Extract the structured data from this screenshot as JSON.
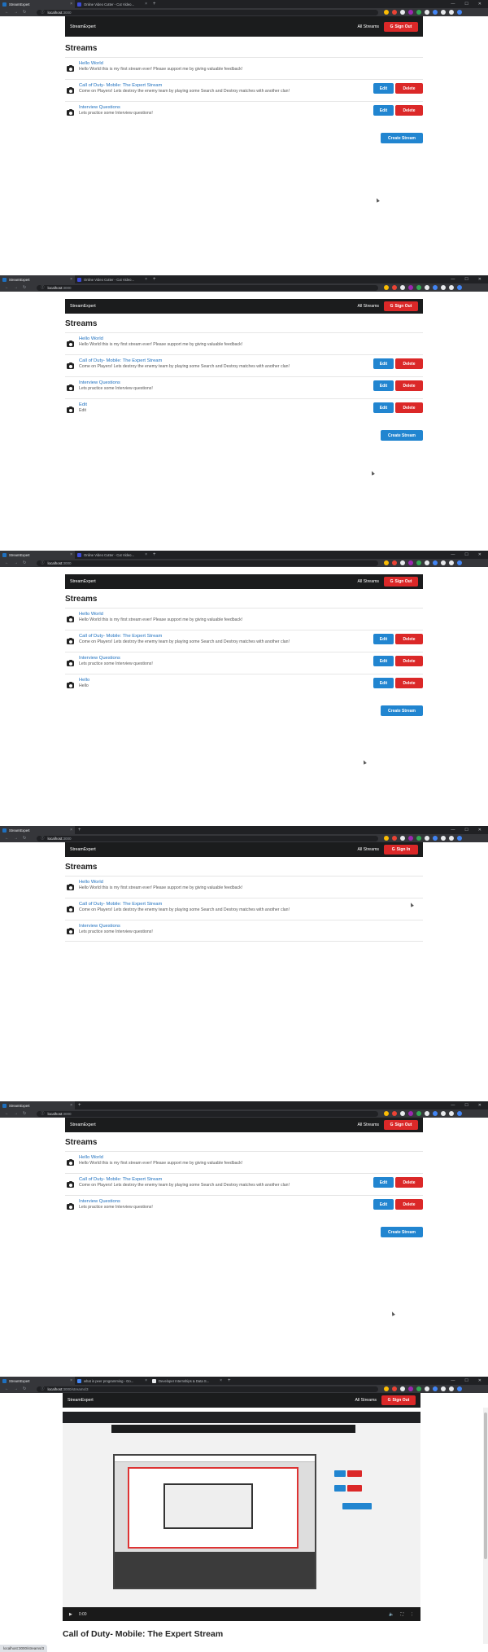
{
  "browser": {
    "tab_main": "StreamExpert",
    "tab_cutter": "Online Video Cutter - Cut Video...",
    "url_host": "localhost",
    "url_port": ":3000",
    "url_path": "/streams/3",
    "tab_search": "what is peer programming - Go...",
    "tab_internships": "Developer Internships & Data S...",
    "status_url": "localhost:3000/streams/3"
  },
  "app": {
    "brand": "StreamExpert",
    "all_streams": "All Streams",
    "sign_out": "Sign Out",
    "sign_in": "Sign In",
    "heading": "Streams",
    "create": "Create Stream",
    "edit": "Edit",
    "delete": "Delete"
  },
  "streams": {
    "hello": {
      "title": "Hello World",
      "desc": "Hello World this is my first stream ever! Please support me by giving valuable feedback!"
    },
    "cod": {
      "title": "Call of Duty- Mobile: The Expert Stream",
      "desc": "Come on Players! Lets destroy the enemy team by playing some Search and Destroy matches with another clan!"
    },
    "interview": {
      "title": "Interview Questions",
      "desc": "Lets practice some Interview questions!"
    },
    "edit_item": {
      "title": "Edit",
      "desc": "Edit"
    },
    "hello_item": {
      "title": "Hello",
      "desc": "Hello"
    }
  },
  "video": {
    "time": "0:00",
    "stream_title": "Call of Duty- Mobile: The Expert Stream"
  },
  "colors": {
    "brand_red": "#db2828",
    "brand_blue": "#2185d0",
    "link": "#1e70bf"
  }
}
